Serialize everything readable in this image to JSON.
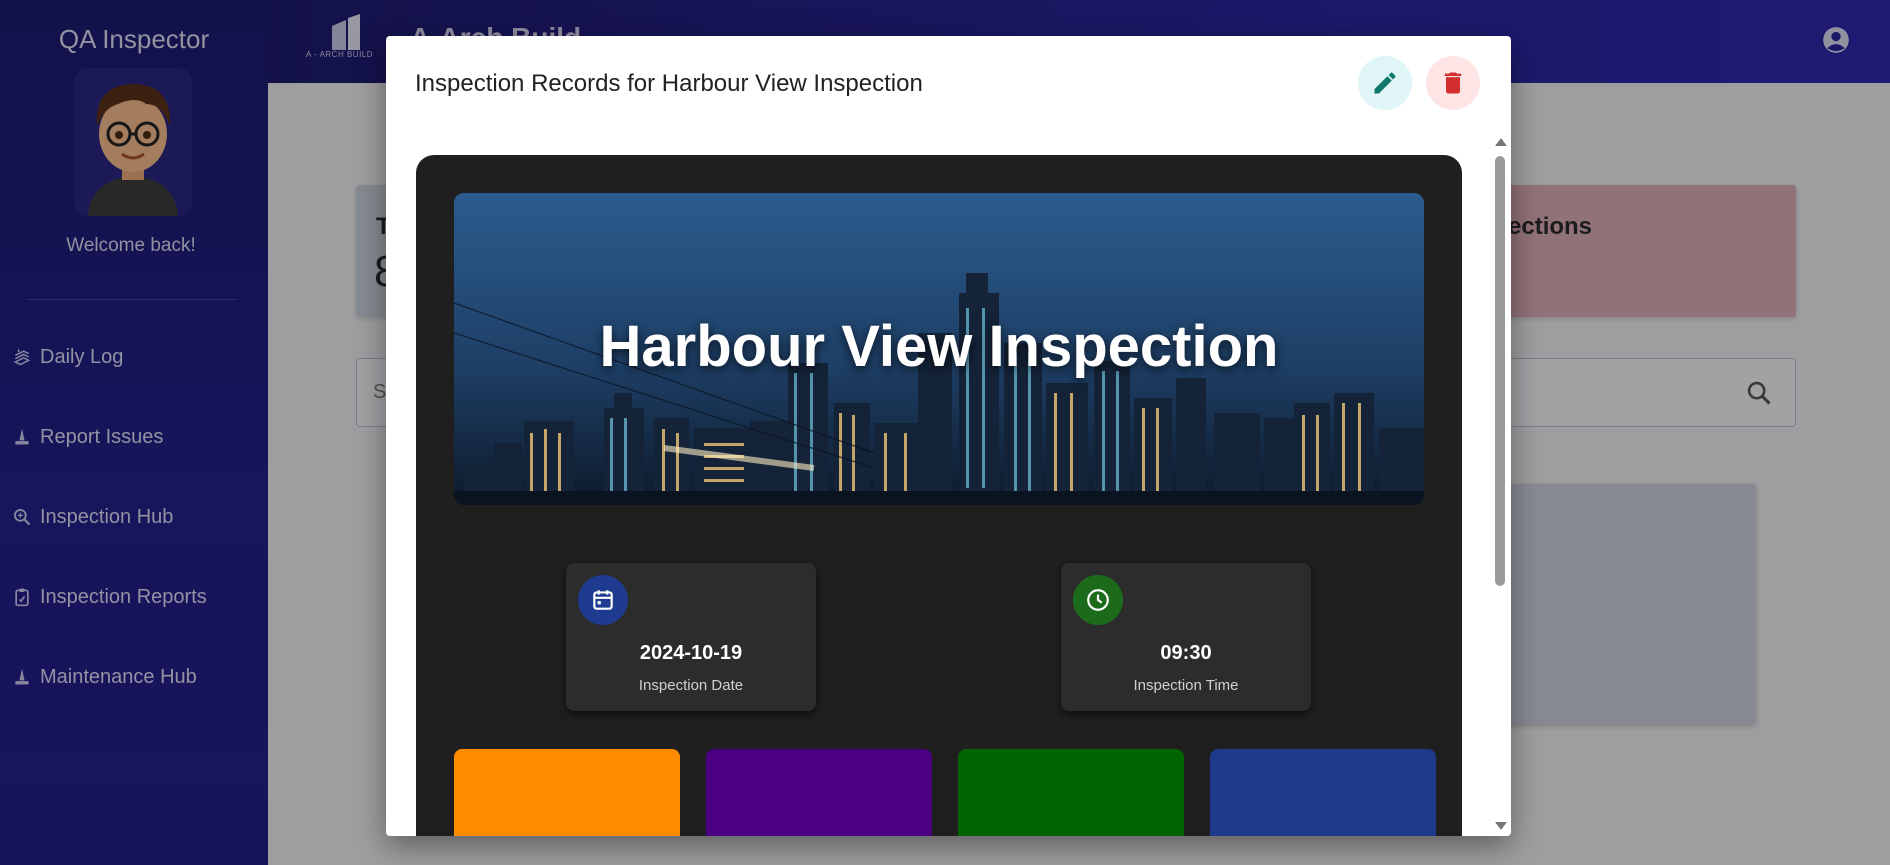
{
  "sidebar": {
    "brand": "QA Inspector",
    "welcome": "Welcome back!",
    "items": [
      {
        "label": "Daily Log",
        "icon": "stack-icon"
      },
      {
        "label": "Report Issues",
        "icon": "cone-icon"
      },
      {
        "label": "Inspection Hub",
        "icon": "search-doc-icon"
      },
      {
        "label": "Inspection Reports",
        "icon": "clipboard-icon"
      },
      {
        "label": "Maintenance Hub",
        "icon": "cone-icon"
      }
    ]
  },
  "topbar": {
    "logo_text": "A - ARCH BUILD",
    "app_title": "A-Arch Build",
    "account_icon": "account-circle-icon"
  },
  "background": {
    "cards": [
      {
        "title": "T",
        "value": "8",
        "color": "#c5cdd6"
      },
      {
        "title": "ections",
        "value": "",
        "color": "#d6a9b2"
      }
    ],
    "search_placeholder": "S",
    "search_icon": "search-icon"
  },
  "modal": {
    "title": "Inspection Records for Harbour View Inspection",
    "edit_icon": "pencil-icon",
    "delete_icon": "trash-icon",
    "colors": {
      "edit_bg": "#dff5f6",
      "edit_fg": "#0f7a6c",
      "delete_bg": "#fde4e5",
      "delete_fg": "#d32f2f"
    },
    "hero_title": "Harbour View Inspection",
    "date": {
      "value": "2024-10-19",
      "label": "Inspection Date",
      "icon": "calendar-icon",
      "icon_bg": "#1f3b8f"
    },
    "time": {
      "value": "09:30",
      "label": "Inspection Time",
      "icon": "clock-icon",
      "icon_bg": "#1b6b1b"
    },
    "tiles": [
      "#ff8c00",
      "#4b0082",
      "#006400",
      "#1e3a8a"
    ]
  }
}
